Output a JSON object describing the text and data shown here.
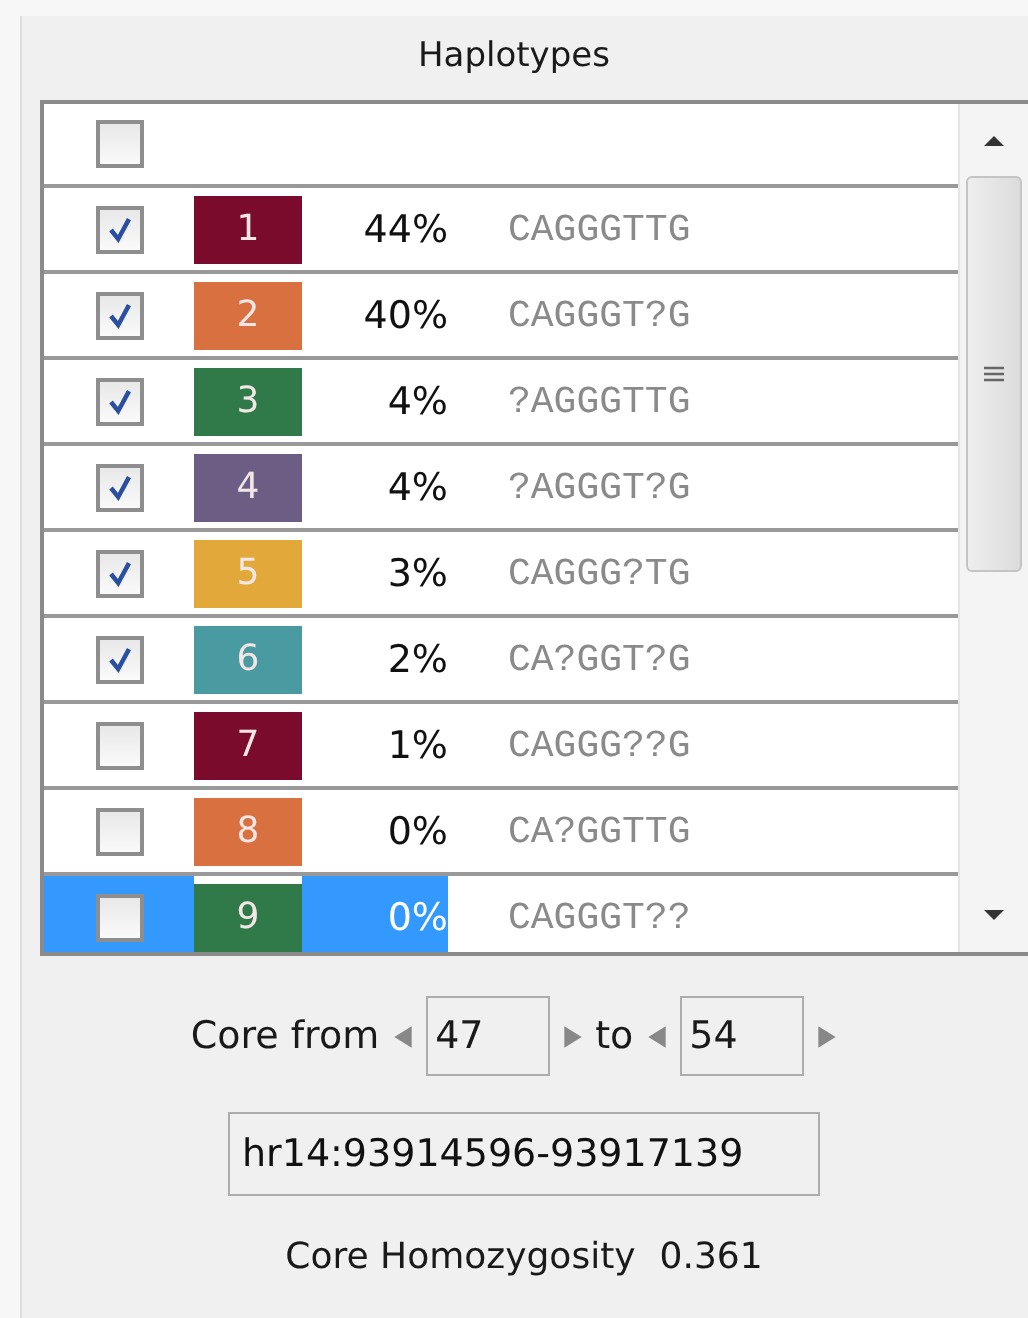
{
  "panel": {
    "title": "Haplotypes"
  },
  "list": {
    "header": {
      "checked": false
    },
    "rows": [
      {
        "checked": true,
        "selected": false,
        "color": "#7a0b2c",
        "number": "1",
        "percent": "44%",
        "sequence": "CAGGGTTG"
      },
      {
        "checked": true,
        "selected": false,
        "color": "#d8713f",
        "number": "2",
        "percent": "40%",
        "sequence": "CAGGGT?G"
      },
      {
        "checked": true,
        "selected": false,
        "color": "#2f7a48",
        "number": "3",
        "percent": "4%",
        "sequence": "?AGGGTTG"
      },
      {
        "checked": true,
        "selected": false,
        "color": "#6c5d84",
        "number": "4",
        "percent": "4%",
        "sequence": "?AGGGT?G"
      },
      {
        "checked": true,
        "selected": false,
        "color": "#e2a83a",
        "number": "5",
        "percent": "3%",
        "sequence": "CAGGG?TG"
      },
      {
        "checked": true,
        "selected": false,
        "color": "#4a9aa1",
        "number": "6",
        "percent": "2%",
        "sequence": "CA?GGT?G"
      },
      {
        "checked": false,
        "selected": false,
        "color": "#7a0b2c",
        "number": "7",
        "percent": "1%",
        "sequence": "CAGGG??G"
      },
      {
        "checked": false,
        "selected": false,
        "color": "#d8713f",
        "number": "8",
        "percent": "0%",
        "sequence": "CA?GGTTG"
      },
      {
        "checked": false,
        "selected": true,
        "color": "#2f7a48",
        "number": "9",
        "percent": "0%",
        "sequence": "CAGGGT??"
      }
    ]
  },
  "core": {
    "from_label": "Core from",
    "from_value": "47",
    "to_label": "to",
    "to_value": "54"
  },
  "region": {
    "value": "hr14:93914596-93917139"
  },
  "homozygosity": {
    "label": "Core Homozygosity",
    "value": "0.361"
  }
}
